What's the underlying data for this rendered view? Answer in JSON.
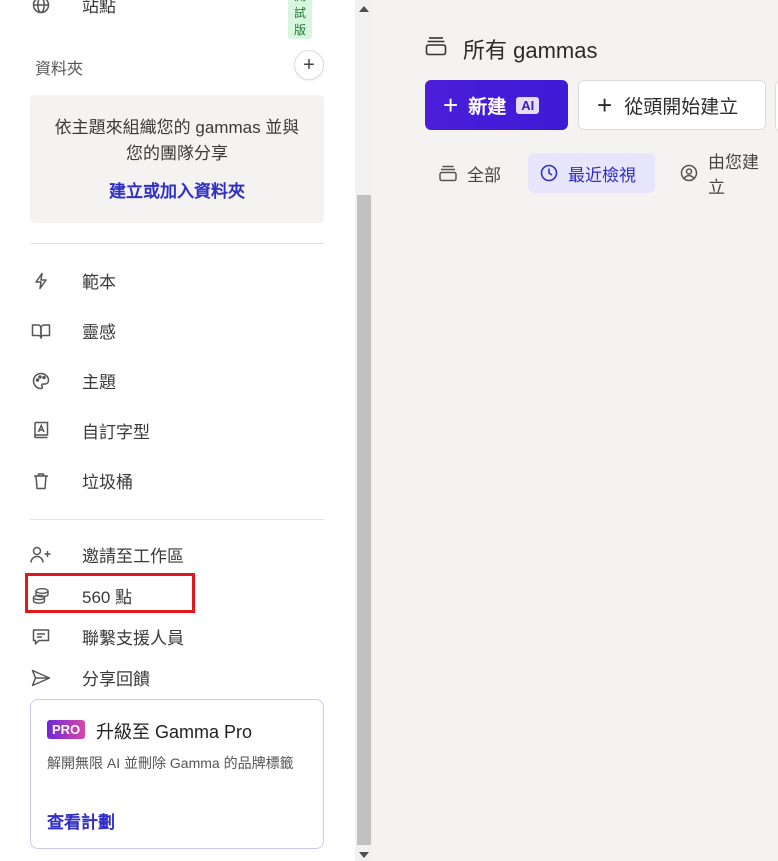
{
  "sidebar": {
    "site_item": {
      "label": "站點",
      "badge": "測試版",
      "icon": "globe-icon"
    },
    "folders": {
      "title": "資料夾",
      "add_label": "+",
      "description": "依主題來組織您的 gammas 並與您的團隊分享",
      "link": "建立或加入資料夾"
    },
    "nav_items": [
      {
        "label": "範本",
        "icon": "lightning-icon"
      },
      {
        "label": "靈感",
        "icon": "book-open-icon"
      },
      {
        "label": "主題",
        "icon": "palette-icon"
      },
      {
        "label": "自訂字型",
        "icon": "font-book-icon"
      },
      {
        "label": "垃圾桶",
        "icon": "trash-icon"
      }
    ],
    "secondary_items": [
      {
        "label": "邀請至工作區",
        "icon": "user-plus-icon"
      },
      {
        "label": "560 點",
        "icon": "coins-icon"
      },
      {
        "label": "聯繫支援人員",
        "icon": "message-icon"
      },
      {
        "label": "分享回饋",
        "icon": "send-icon"
      }
    ],
    "pro_card": {
      "badge": "PRO",
      "title": "升級至 Gamma Pro",
      "description": "解開無限 AI 並刪除 Gamma 的品牌標籤",
      "link": "查看計劃"
    }
  },
  "main": {
    "title": "所有 gammas",
    "new_button": {
      "label": "新建",
      "tag": "AI"
    },
    "blank_button": {
      "label": "從頭開始建立"
    },
    "tabs": [
      {
        "label": "全部",
        "active": false,
        "icon": "stack-icon"
      },
      {
        "label": "最近檢視",
        "active": true,
        "icon": "clock-icon"
      },
      {
        "label": "由您建立",
        "active": false,
        "icon": "user-circle-icon"
      }
    ]
  },
  "colors": {
    "accent": "#3c1ad6",
    "link": "#2f2fc8",
    "highlight_box": "#e0191e",
    "beta_badge_bg": "#d8f5dd"
  }
}
